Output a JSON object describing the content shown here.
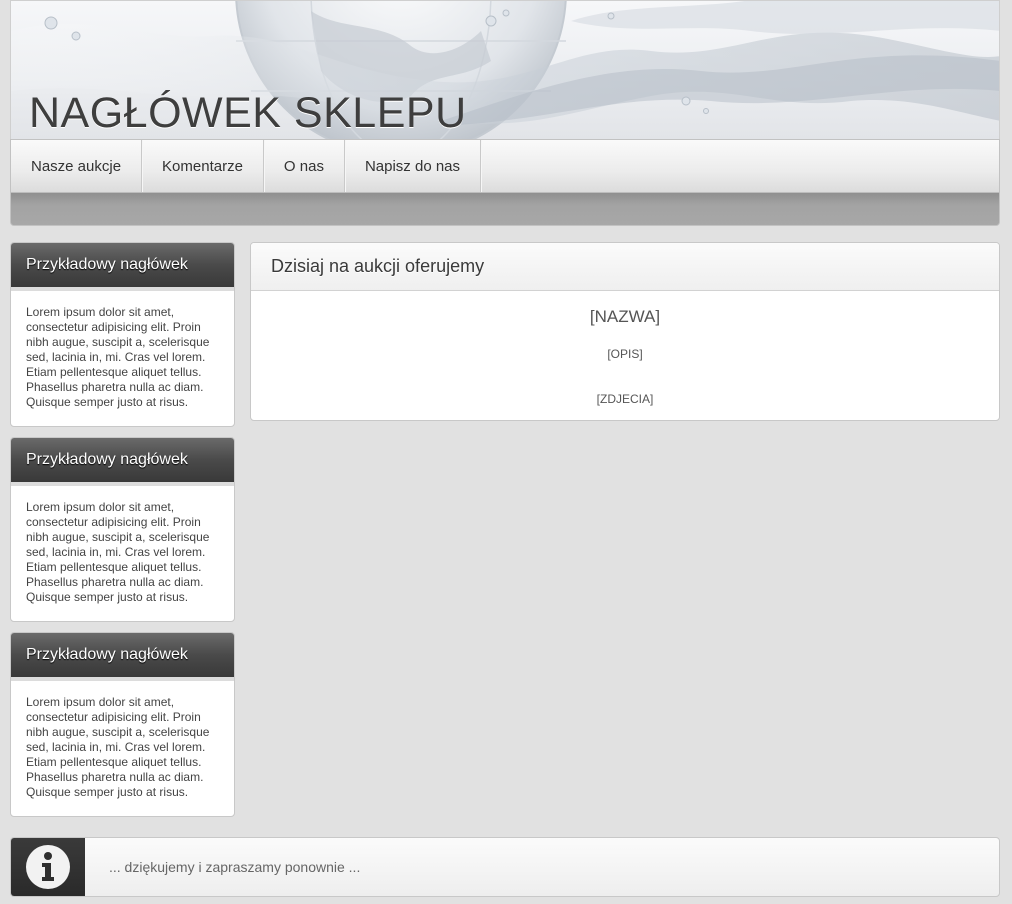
{
  "header": {
    "shop_title": "NAGŁÓWEK SKLEPU"
  },
  "nav": {
    "items": [
      {
        "label": "Nasze aukcje"
      },
      {
        "label": "Komentarze"
      },
      {
        "label": "O nas"
      },
      {
        "label": "Napisz do nas"
      }
    ]
  },
  "sidebar": {
    "boxes": [
      {
        "title": "Przykładowy nagłówek",
        "text": "Lorem ipsum dolor sit amet, consectetur adipisicing elit. Proin nibh augue, suscipit a, scelerisque sed, lacinia in, mi. Cras vel lorem. Etiam pellentesque aliquet tellus. Phasellus pharetra nulla ac diam. Quisque semper justo at risus."
      },
      {
        "title": "Przykładowy nagłówek",
        "text": "Lorem ipsum dolor sit amet, consectetur adipisicing elit. Proin nibh augue, suscipit a, scelerisque sed, lacinia in, mi. Cras vel lorem. Etiam pellentesque aliquet tellus. Phasellus pharetra nulla ac diam. Quisque semper justo at risus."
      },
      {
        "title": "Przykładowy nagłówek",
        "text": "Lorem ipsum dolor sit amet, consectetur adipisicing elit. Proin nibh augue, suscipit a, scelerisque sed, lacinia in, mi. Cras vel lorem. Etiam pellentesque aliquet tellus. Phasellus pharetra nulla ac diam. Quisque semper justo at risus."
      }
    ]
  },
  "main": {
    "title": "Dzisiaj na aukcji oferujemy",
    "product_name": "[NAZWA]",
    "product_description": "[OPIS]",
    "product_photos": "[ZDJECIA]"
  },
  "footer": {
    "icon": "info-icon",
    "text": "... dziękujemy i zapraszamy ponownie ..."
  },
  "colors": {
    "page_background": "#e1e1e1",
    "sidebar_header": "#4a4a4a",
    "footer_icon_background": "#2f2f2f",
    "nav_strip": "#a6a6a6"
  }
}
